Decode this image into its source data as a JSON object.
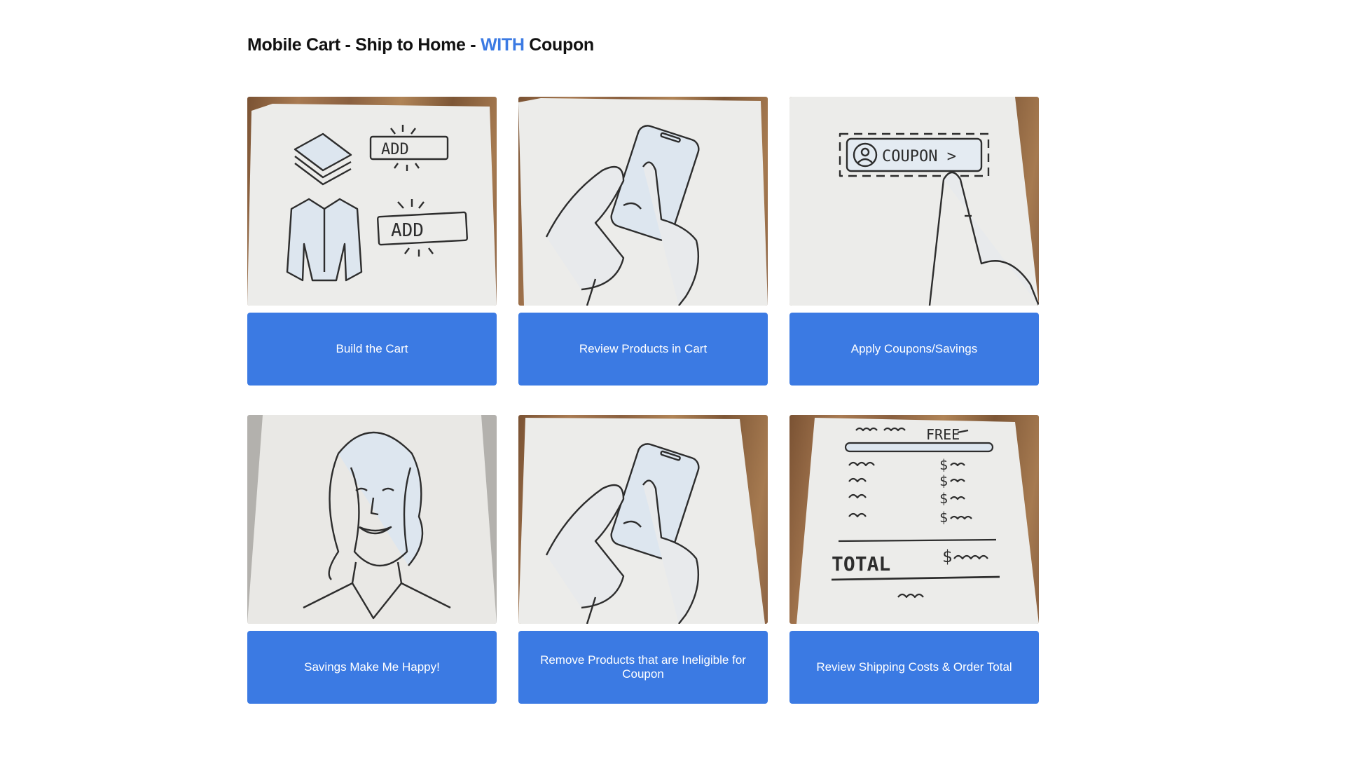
{
  "page": {
    "title_prefix": "Mobile Cart - Ship to Home - ",
    "title_accent": "WITH",
    "title_suffix": " Coupon",
    "accent_color": "#3b7ae3"
  },
  "cards": [
    {
      "caption": "Build the Cart",
      "sketch_text": [
        "ADD",
        "ADD"
      ],
      "icon": "folded-clothes-and-vest-sketch"
    },
    {
      "caption": "Review Products in Cart",
      "icon": "hands-holding-phone-sketch"
    },
    {
      "caption": "Apply Coupons/Savings",
      "sketch_text": [
        "COUPON >"
      ],
      "icon": "finger-tapping-coupon-button-sketch"
    },
    {
      "caption": "Savings Make Me Happy!",
      "icon": "smiling-woman-sketch"
    },
    {
      "caption": "Remove Products that are Ineligible for Coupon",
      "icon": "hands-holding-phone-sketch"
    },
    {
      "caption": "Review Shipping Costs & Order Total",
      "sketch_text": [
        "FREE",
        "$",
        "$",
        "$",
        "$",
        "TOTAL",
        "$"
      ],
      "icon": "receipt-total-sketch"
    }
  ]
}
